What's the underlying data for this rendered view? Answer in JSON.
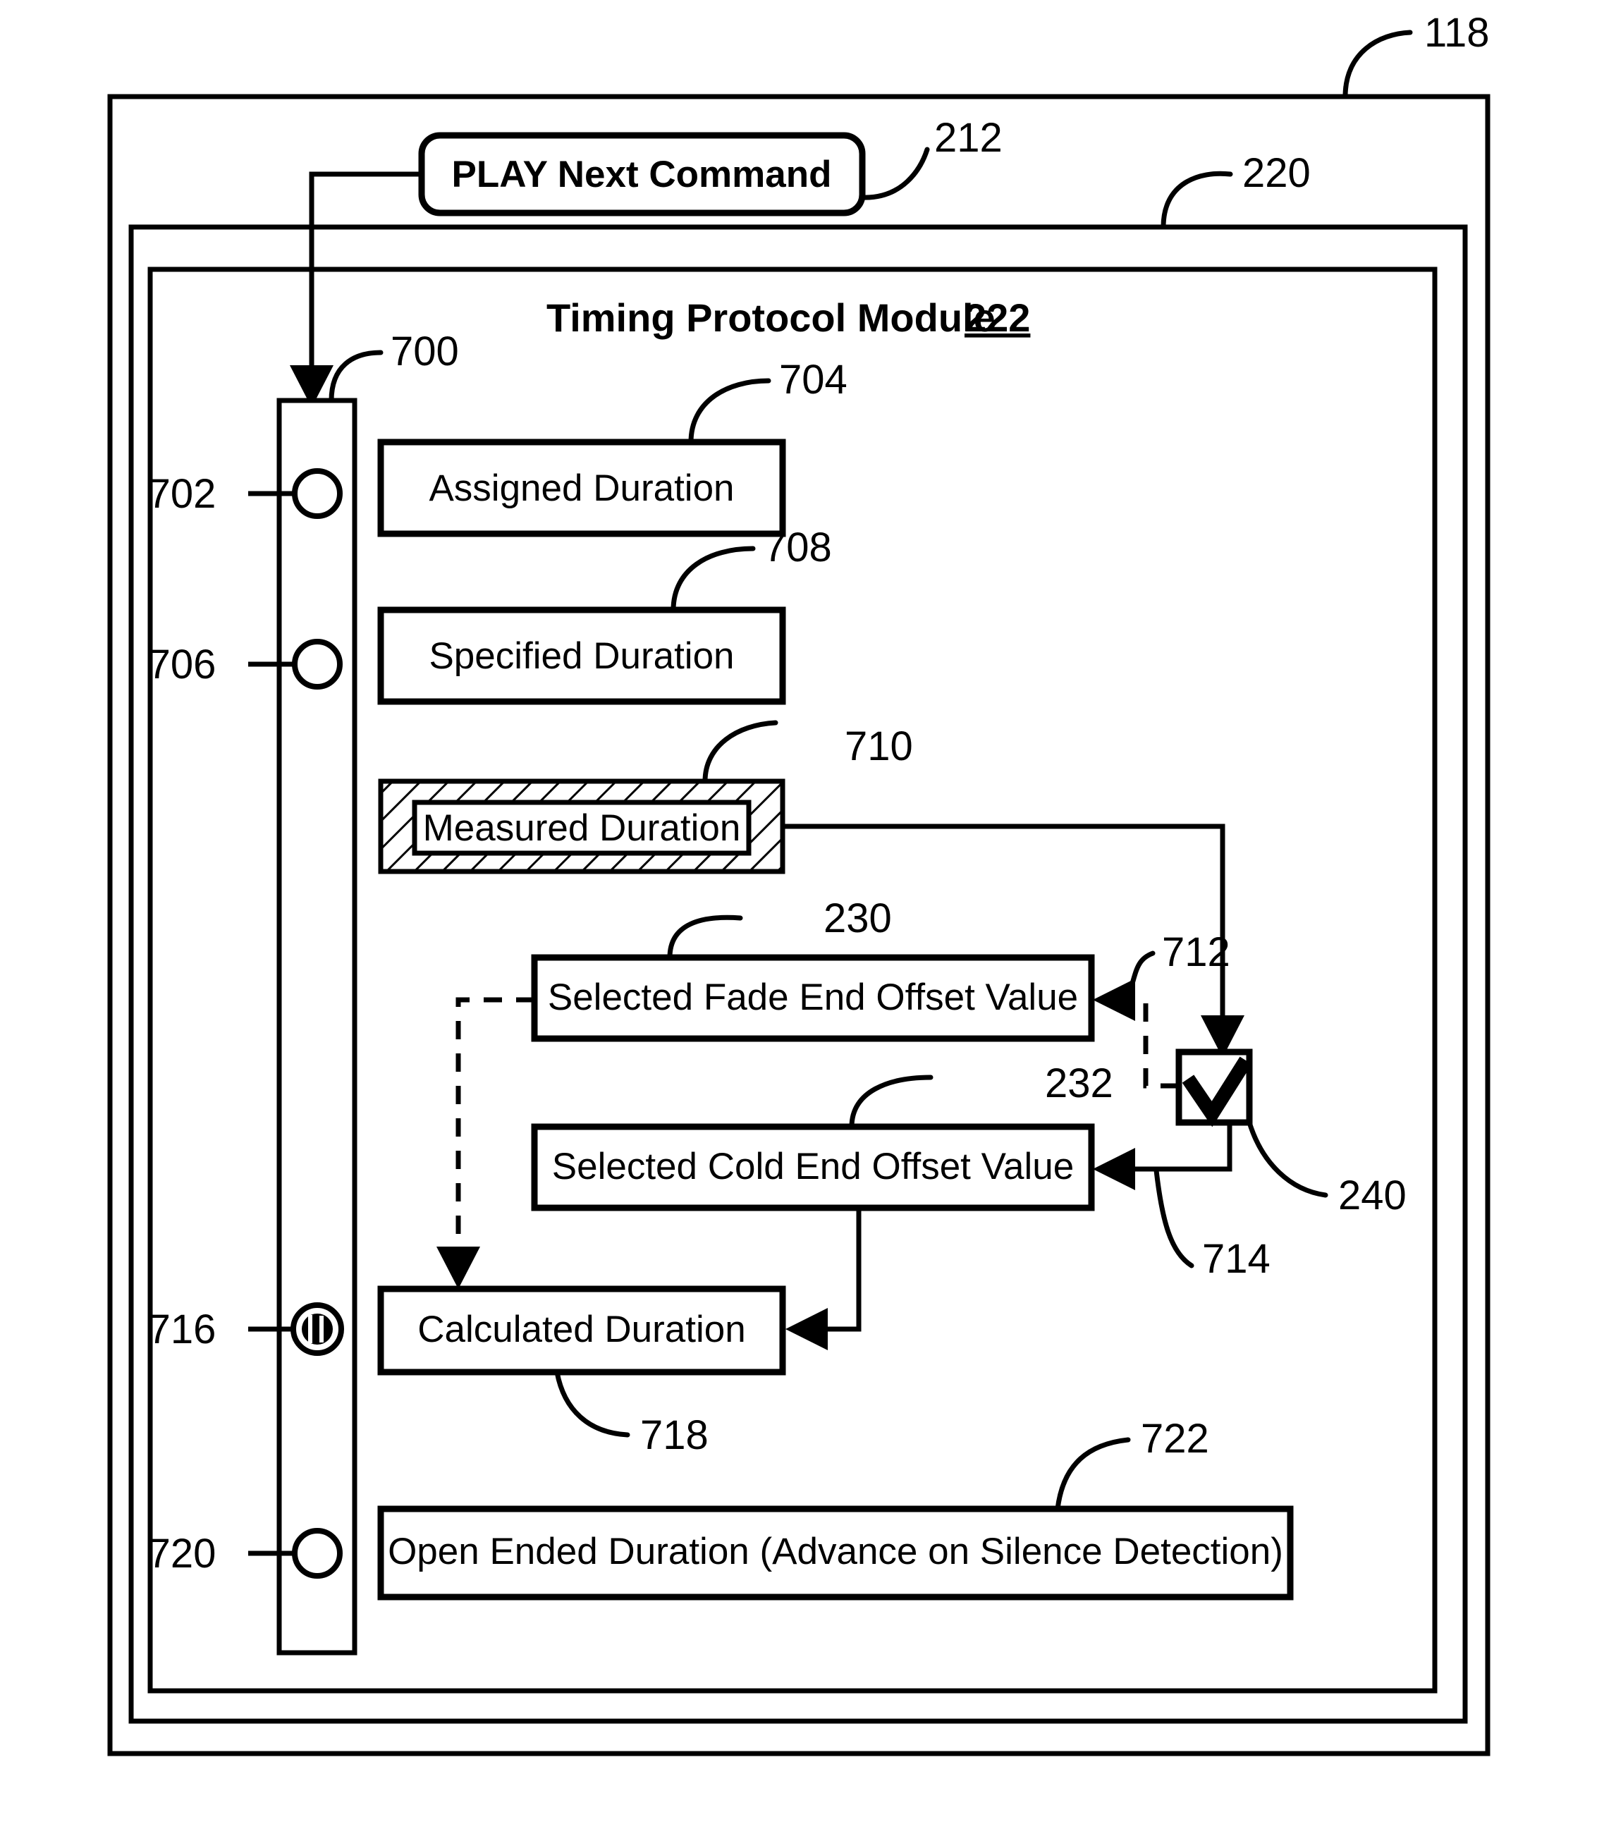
{
  "figure": {
    "type": "patent-flow-diagram",
    "outer_ref": "118",
    "middle_ref": "220",
    "inner_ref": "222",
    "module_title": "Timing Protocol Module",
    "module_ref": "222"
  },
  "command_box": {
    "label": "PLAY Next Command",
    "ref": "212"
  },
  "selector_bar": {
    "ref": "700",
    "options": [
      {
        "ref": "702",
        "state": "unselected",
        "target": "assigned-duration"
      },
      {
        "ref": "706",
        "state": "unselected",
        "target": "specified-duration"
      },
      {
        "ref": "716",
        "state": "selected",
        "target": "calculated-duration"
      },
      {
        "ref": "720",
        "state": "unselected",
        "target": "open-ended-duration"
      }
    ]
  },
  "boxes": [
    {
      "id": "assigned-duration",
      "label": "Assigned Duration",
      "ref": "704",
      "style": "plain"
    },
    {
      "id": "specified-duration",
      "label": "Specified Duration",
      "ref": "708",
      "style": "plain"
    },
    {
      "id": "measured-duration",
      "label": "Measured Duration",
      "ref": "710",
      "style": "hatched"
    },
    {
      "id": "selected-fade-end-offset-value",
      "label": "Selected Fade End Offset Value",
      "ref": "230",
      "style": "plain"
    },
    {
      "id": "selected-cold-end-offset-value",
      "label": "Selected Cold End Offset Value",
      "ref": "232",
      "style": "plain"
    },
    {
      "id": "calculated-duration",
      "label": "Calculated Duration",
      "ref": "718",
      "style": "plain"
    },
    {
      "id": "open-ended-duration",
      "label": "Open Ended Duration (Advance on Silence Detection)",
      "ref": "722",
      "style": "plain"
    }
  ],
  "checkbox": {
    "ref": "240",
    "state": "checked",
    "icon": "checkmark-icon"
  },
  "connector_refs": {
    "measured_to_checkbox": "712",
    "checkbox_to_cold_end": "714"
  },
  "reference_numerals": [
    "118",
    "212",
    "220",
    "222",
    "700",
    "702",
    "704",
    "706",
    "708",
    "710",
    "712",
    "714",
    "716",
    "718",
    "720",
    "722",
    "230",
    "232",
    "240"
  ],
  "colors": {
    "line": "#000000",
    "background": "#ffffff"
  }
}
